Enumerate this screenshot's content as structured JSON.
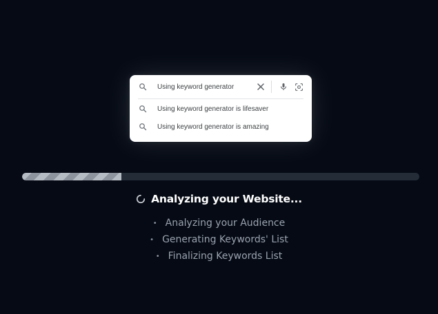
{
  "search": {
    "query": "Using keyword generator",
    "suggestions": [
      "Using keyword generator is lifesaver",
      "Using keyword generator is amazing"
    ]
  },
  "icons": {
    "search": "search-icon",
    "clear": "close-icon",
    "mic": "microphone-icon",
    "lens": "lens-icon",
    "spinner": "spinner-icon"
  },
  "progress": {
    "value": 0.25
  },
  "status": {
    "title": "Analyzing your Website...",
    "steps": [
      "Analyzing your Audience",
      "Generating Keywords' List",
      "Finalizing Keywords List"
    ]
  },
  "colors": {
    "background": "#050a14",
    "track": "#232c37",
    "bar_light": "#b6bcc4",
    "bar_dark": "#8d949d",
    "step_text": "#9aa3b0"
  }
}
